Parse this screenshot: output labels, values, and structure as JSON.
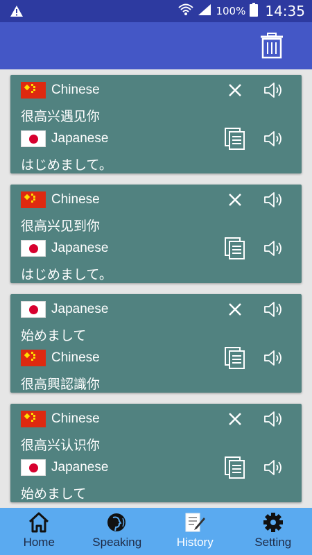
{
  "status": {
    "battery": "100%",
    "time": "14:35"
  },
  "toolbar": {
    "delete_icon": "trash-icon"
  },
  "cards": [
    {
      "src_lang": "Chinese",
      "src_flag": "cn",
      "src_text": "很高兴遇见你",
      "dst_lang": "Japanese",
      "dst_flag": "jp",
      "dst_text": "はじめまして。"
    },
    {
      "src_lang": "Chinese",
      "src_flag": "cn",
      "src_text": "很高兴见到你",
      "dst_lang": "Japanese",
      "dst_flag": "jp",
      "dst_text": "はじめまして。"
    },
    {
      "src_lang": "Japanese",
      "src_flag": "jp",
      "src_text": "始めまして",
      "dst_lang": "Chinese",
      "dst_flag": "cn",
      "dst_text": "很高興認識你"
    },
    {
      "src_lang": "Chinese",
      "src_flag": "cn",
      "src_text": "很高兴认识你",
      "dst_lang": "Japanese",
      "dst_flag": "jp",
      "dst_text": "始めまして"
    }
  ],
  "nav": {
    "home": "Home",
    "speaking": "Speaking",
    "history": "History",
    "setting": "Setting",
    "active": "history"
  },
  "colors": {
    "status_bar": "#2d3aa0",
    "app_bar": "#4457c6",
    "card": "#518280",
    "bottom_nav": "#5aaaf0"
  }
}
